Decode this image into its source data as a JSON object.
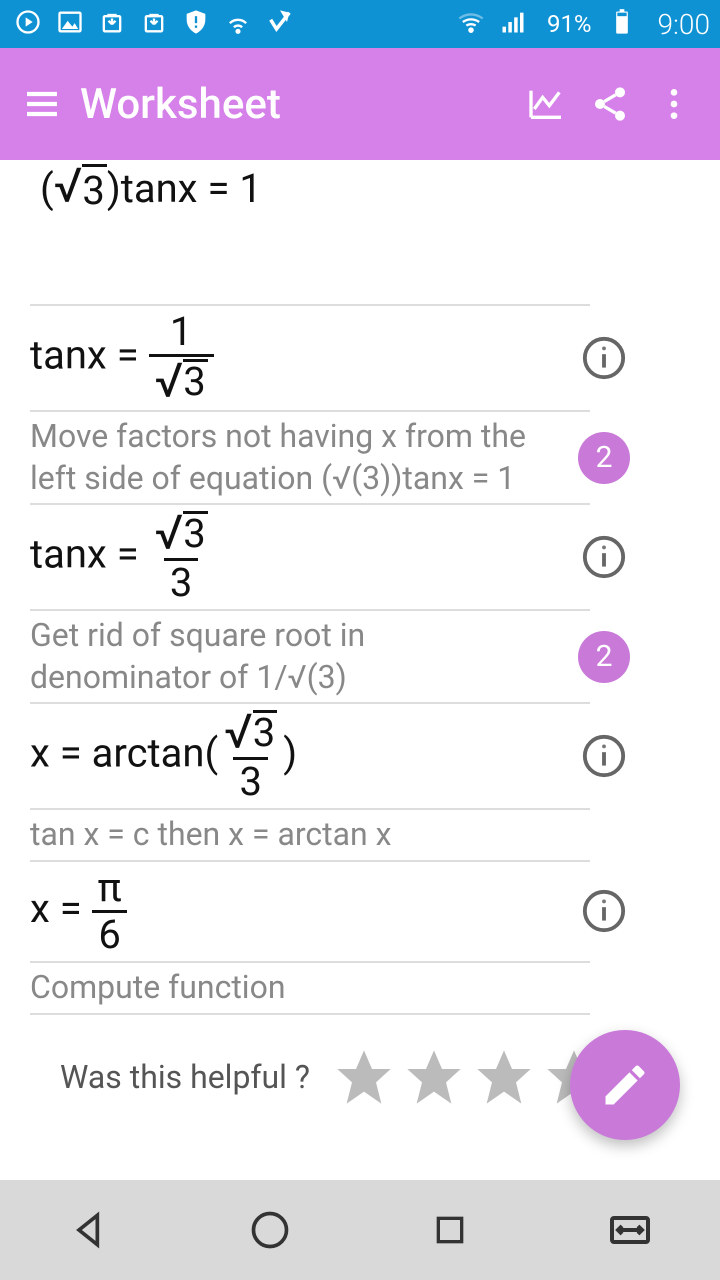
{
  "statusbar": {
    "battery_pct": "91%",
    "clock": "9:00"
  },
  "appbar": {
    "title": "Worksheet"
  },
  "problem": {
    "line": "(√3)tanx = 1"
  },
  "steps": [
    {
      "kind": "eq",
      "left": "tanx = ",
      "num": "1",
      "den_sqrt": "3",
      "explain": "Move factors not having x from the left side of equation (√(3))tanx = 1",
      "badge": "2"
    },
    {
      "kind": "eq",
      "left": "tanx = ",
      "num_sqrt": "3",
      "den": "3",
      "explain": "Get rid of square root in denominator of 1/√(3)",
      "badge": "2"
    },
    {
      "kind": "eq",
      "arctan": true,
      "left": "x = arctan(",
      "num_sqrt": "3",
      "den": "3",
      "right": ")",
      "explain": "tan x = c   then   x = arctan x"
    },
    {
      "kind": "eq",
      "left": "x = ",
      "num": "π",
      "den": "6",
      "explain": "Compute function"
    }
  ],
  "rating": {
    "label": "Was this helpful ?"
  }
}
